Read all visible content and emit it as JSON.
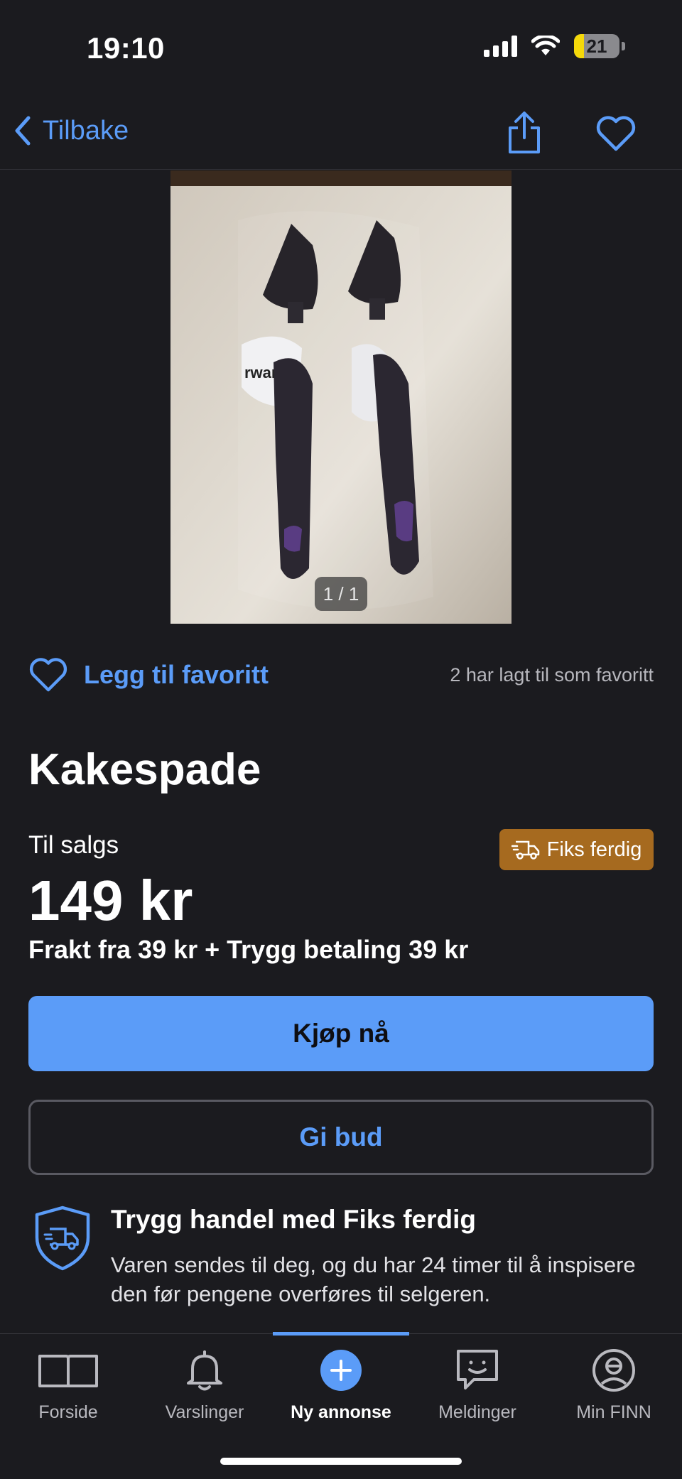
{
  "status_bar": {
    "time": "19:10",
    "battery": "21"
  },
  "navbar": {
    "back_label": "Tilbake"
  },
  "photo": {
    "counter": "1 / 1"
  },
  "favorite": {
    "label": "Legg til favoritt",
    "count_text": "2 har lagt til som favoritt"
  },
  "listing": {
    "title": "Kakespade",
    "status": "Til salgs",
    "badge": "Fiks ferdig",
    "price": "149 kr",
    "shipping": "Frakt fra 39 kr + Trygg betaling 39 kr"
  },
  "actions": {
    "buy": "Kjøp nå",
    "bid": "Gi bud"
  },
  "safe_trade": {
    "title": "Trygg handel med Fiks ferdig",
    "text": "Varen sendes til deg, og du har 24 timer til å inspisere den før pengene overføres til selgeren."
  },
  "tabs": [
    {
      "label": "Forside",
      "icon": "book-icon"
    },
    {
      "label": "Varslinger",
      "icon": "bell-icon"
    },
    {
      "label": "Ny annonse",
      "icon": "plus-circle-icon",
      "active": true
    },
    {
      "label": "Meldinger",
      "icon": "chat-icon"
    },
    {
      "label": "Min FINN",
      "icon": "profile-icon"
    }
  ],
  "colors": {
    "accent": "#5b9cf8",
    "background": "#1b1b1f",
    "badge": "#a66a1f"
  }
}
